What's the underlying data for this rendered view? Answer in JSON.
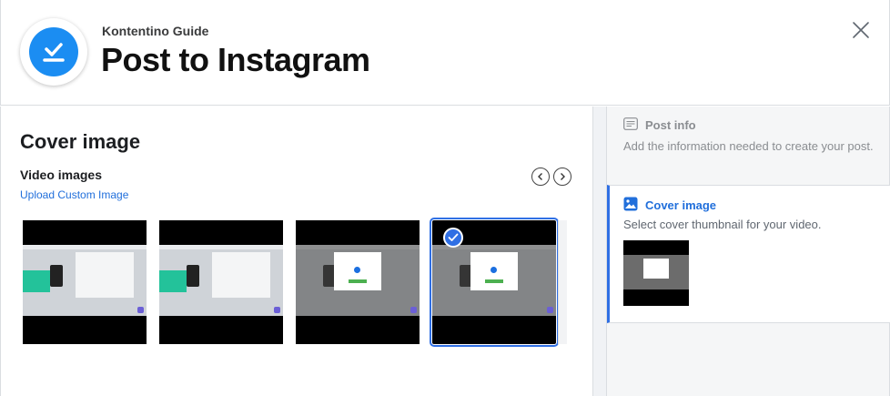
{
  "header": {
    "brand": "Kontentino Guide",
    "title": "Post to Instagram"
  },
  "main": {
    "section_title": "Cover image",
    "subsection_title": "Video images",
    "upload_link": "Upload Custom Image",
    "thumbnails": [
      {
        "variant": "app",
        "selected": false
      },
      {
        "variant": "app",
        "selected": false
      },
      {
        "variant": "dialog",
        "selected": false
      },
      {
        "variant": "dialog",
        "selected": true
      }
    ]
  },
  "steps": [
    {
      "icon": "list-icon",
      "title": "Post info",
      "description": "Add the information needed to create your post.",
      "active": false
    },
    {
      "icon": "image-icon",
      "title": "Cover image",
      "description": "Select cover thumbnail for your video.",
      "active": true
    }
  ],
  "colors": {
    "accent": "#216fdb",
    "logo": "#1b8df2",
    "selection": "#2f6fe4"
  }
}
